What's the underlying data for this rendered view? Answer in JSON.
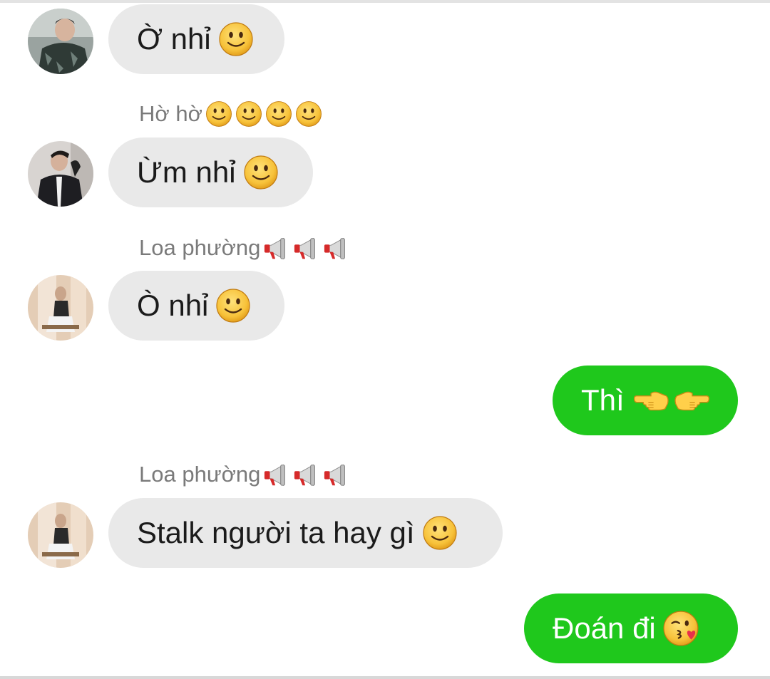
{
  "messages": [
    {
      "id": "m1",
      "side": "incoming",
      "nickname": "",
      "text": "Ờ nhỉ",
      "emoji": "slightly-smiling-face-icon"
    },
    {
      "id": "m2",
      "side": "incoming",
      "nickname": "Hờ hờ",
      "nickname_emoji": [
        "slightly-smiling-face-icon",
        "slightly-smiling-face-icon",
        "slightly-smiling-face-icon",
        "slightly-smiling-face-icon"
      ],
      "text": "Ừm nhỉ",
      "emoji": "slightly-smiling-face-icon"
    },
    {
      "id": "m3",
      "side": "incoming",
      "nickname": "Loa phường",
      "nickname_emoji": [
        "megaphone-icon",
        "megaphone-icon",
        "megaphone-icon"
      ],
      "text": "Ò nhỉ",
      "emoji": "slightly-smiling-face-icon"
    },
    {
      "id": "m4",
      "side": "outgoing",
      "text": "Thì",
      "emoji": [
        "pointing-left-icon",
        "pointing-right-icon"
      ]
    },
    {
      "id": "m5",
      "side": "incoming",
      "nickname": "Loa phường",
      "nickname_emoji": [
        "megaphone-icon",
        "megaphone-icon",
        "megaphone-icon"
      ],
      "text": "Stalk người ta hay gì",
      "emoji": "slightly-smiling-face-icon"
    },
    {
      "id": "m6",
      "side": "outgoing",
      "text": "Đoán đi",
      "emoji": "face-blowing-kiss-icon"
    }
  ],
  "colors": {
    "incoming_bubble": "#e9e9e9",
    "outgoing_bubble": "#1fc81c",
    "nickname_text": "#7a7a7a",
    "incoming_text": "#1b1b1b",
    "outgoing_text": "#ffffff"
  }
}
